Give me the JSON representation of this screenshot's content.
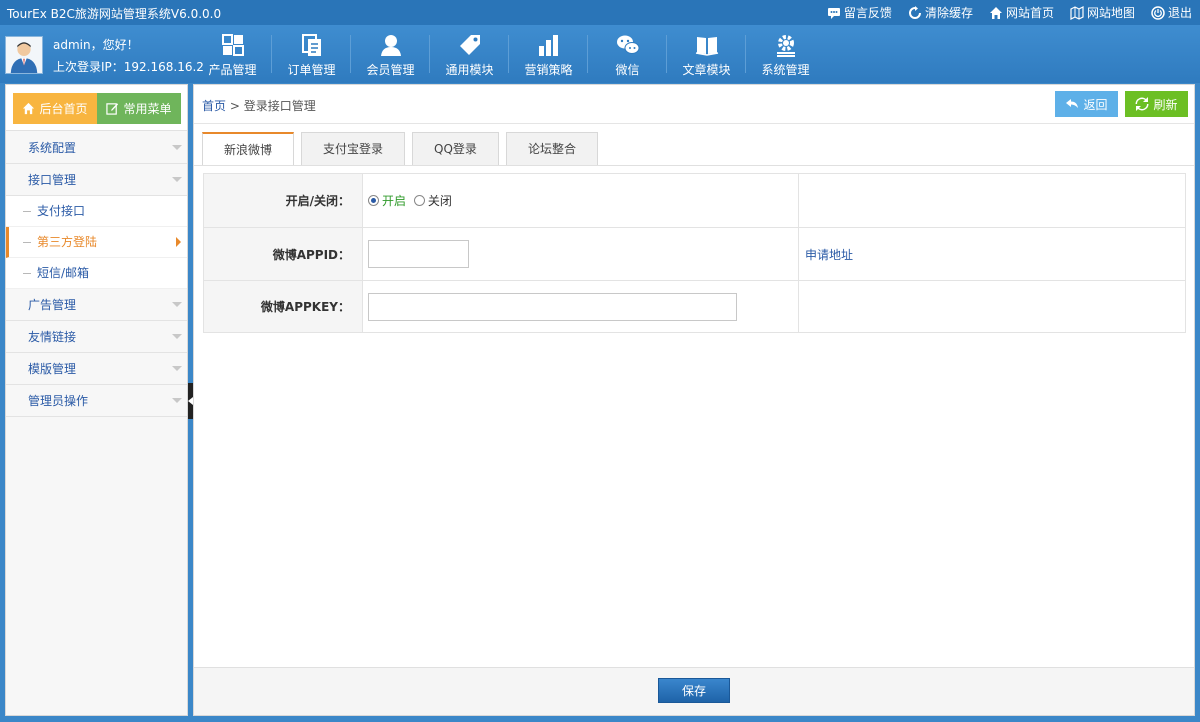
{
  "titlebar": {
    "title": "TourEx B2C旅游网站管理系统V6.0.0.0",
    "links": [
      {
        "label": "留言反馈",
        "icon": "message-icon"
      },
      {
        "label": "清除缓存",
        "icon": "refresh-icon"
      },
      {
        "label": "网站首页",
        "icon": "home-icon"
      },
      {
        "label": "网站地图",
        "icon": "sitemap-icon"
      },
      {
        "label": "退出",
        "icon": "power-icon"
      }
    ]
  },
  "user": {
    "greeting": "admin，您好！",
    "last_login": "上次登录IP：192.168.16.2"
  },
  "mainnav": [
    {
      "label": "产品管理",
      "icon": "grid-icon"
    },
    {
      "label": "订单管理",
      "icon": "document-icon"
    },
    {
      "label": "会员管理",
      "icon": "user-icon"
    },
    {
      "label": "通用模块",
      "icon": "tag-icon"
    },
    {
      "label": "营销策略",
      "icon": "bar-chart-icon"
    },
    {
      "label": "微信",
      "icon": "wechat-icon"
    },
    {
      "label": "文章模块",
      "icon": "book-icon"
    },
    {
      "label": "系统管理",
      "icon": "gear-icon"
    }
  ],
  "sidebar": {
    "home_label": "后台首页",
    "common_label": "常用菜单",
    "groups": [
      {
        "label": "系统配置"
      },
      {
        "label": "接口管理"
      },
      {
        "label": "广告管理"
      },
      {
        "label": "友情链接"
      },
      {
        "label": "模版管理"
      },
      {
        "label": "管理员操作"
      }
    ],
    "subitems": [
      {
        "label": "支付接口"
      },
      {
        "label": "第三方登陆"
      },
      {
        "label": "短信/邮箱"
      }
    ]
  },
  "content": {
    "breadcrumb_home": "首页",
    "breadcrumb_sep": ">",
    "breadcrumb_current": "登录接口管理",
    "back_label": "返回",
    "refresh_label": "刷新",
    "tabs": [
      {
        "label": "新浪微博"
      },
      {
        "label": "支付宝登录"
      },
      {
        "label": "QQ登录"
      },
      {
        "label": "论坛整合"
      }
    ],
    "form": {
      "toggle_label": "开启/关闭：",
      "on_label": "开启",
      "off_label": "关闭",
      "appid_label": "微博APPID：",
      "appid_value": "",
      "apply_link": "申请地址",
      "appkey_label": "微博APPKEY：",
      "appkey_value": ""
    },
    "save_label": "保存"
  },
  "colors": {
    "accent_blue": "#2a75b8",
    "active_orange": "#e8892b",
    "home_button": "#f8b540",
    "common_button": "#6fb55b",
    "refresh_button": "#6cbf24",
    "back_button": "#5eb0e8"
  }
}
